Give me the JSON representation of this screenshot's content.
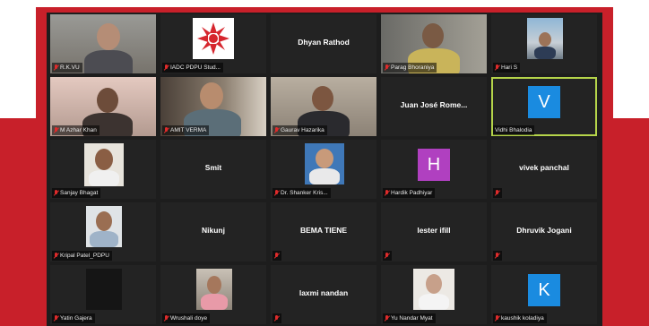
{
  "app": {
    "accent": "#c8202a",
    "active_border": "#b5d44a",
    "tile_bg": "#232323",
    "muted_icon": "mic-muted-icon"
  },
  "participants": [
    {
      "name": "R.K.VU",
      "center": ""
    },
    {
      "name": "IADC PDPU Stud...",
      "center": ""
    },
    {
      "name": "",
      "center": "Dhyan Rathod"
    },
    {
      "name": "Parag Bhoraniya",
      "center": ""
    },
    {
      "name": "Hari S",
      "center": ""
    },
    {
      "name": "M Azhar Khan",
      "center": ""
    },
    {
      "name": "AMIT VERMA",
      "center": ""
    },
    {
      "name": "Gaurav Hazarika",
      "center": ""
    },
    {
      "name": "",
      "center": "Juan José Rome..."
    },
    {
      "name": "Vidhi Bhalodia",
      "center": "",
      "avatar": "V",
      "avatar_color": "#1a8be0"
    },
    {
      "name": "Sanjay Bhagat",
      "center": ""
    },
    {
      "name": "",
      "center": "Smit"
    },
    {
      "name": "Dr. Shanker Kris...",
      "center": ""
    },
    {
      "name": "Hardik Padhiyar",
      "center": "",
      "avatar": "H",
      "avatar_color": "#b040c0"
    },
    {
      "name": "",
      "center": "vivek panchal"
    },
    {
      "name": "Kripal Patel_PDPU",
      "center": ""
    },
    {
      "name": "",
      "center": "Nikunj"
    },
    {
      "name": "",
      "center": "BEMA TIENE"
    },
    {
      "name": "",
      "center": "lester ifill"
    },
    {
      "name": "",
      "center": "Dhruvik Jogani"
    },
    {
      "name": "Yatin Gajera",
      "center": ""
    },
    {
      "name": "Wrushali doye",
      "center": ""
    },
    {
      "name": "",
      "center": "laxmi nandan"
    },
    {
      "name": "Yu Nandar Myat",
      "center": ""
    },
    {
      "name": "kaushik koladiya",
      "center": "",
      "avatar": "K",
      "avatar_color": "#1a8be0"
    }
  ]
}
